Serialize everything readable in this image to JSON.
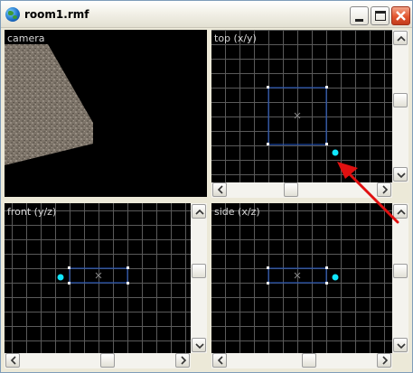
{
  "window": {
    "title": "room1.rmf",
    "icon": "globe-icon",
    "buttons": [
      "minimize",
      "maximize",
      "close"
    ]
  },
  "viewports": {
    "camera": {
      "label": "camera"
    },
    "top": {
      "label": "top (x/y)"
    },
    "front": {
      "label": "front (y/z)"
    },
    "side": {
      "label": "side (x/z)"
    }
  },
  "colors": {
    "viewport_bg": "#000000",
    "grid_line": "#5a5a5a",
    "brush_outline": "#1f56c8",
    "handle_cyan": "#10e6ff",
    "annotation_arrow": "#e01010"
  }
}
